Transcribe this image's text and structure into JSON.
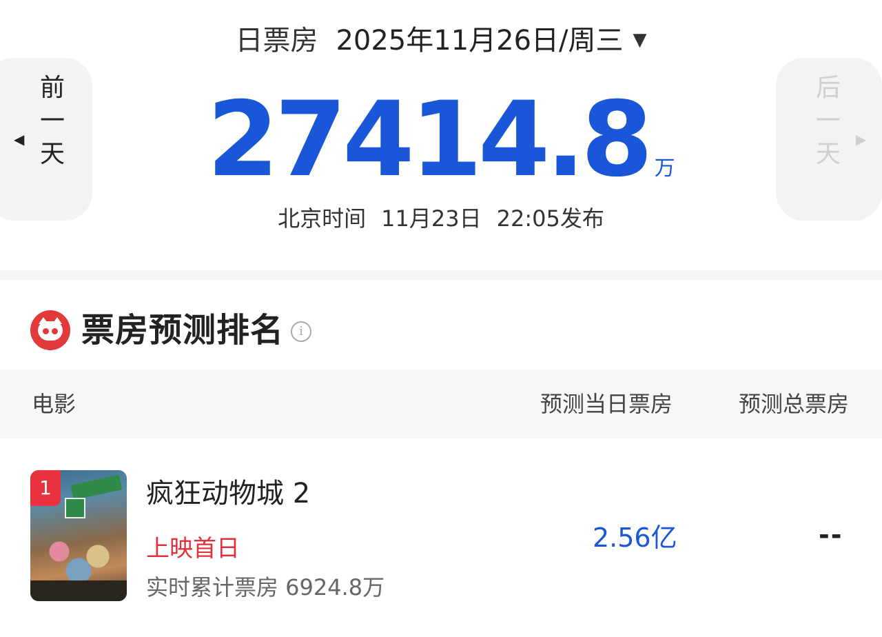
{
  "header": {
    "label": "日票房",
    "date": "2025年11月26日/周三",
    "caret": "▼"
  },
  "nav": {
    "prev_label": "前一天",
    "prev_chars": [
      "前",
      "一",
      "天"
    ],
    "prev_arrow": "◀",
    "next_label": "后一天",
    "next_chars": [
      "后",
      "一",
      "天"
    ],
    "next_arrow": "▶"
  },
  "total": {
    "value": "27414.8",
    "unit": "万"
  },
  "release": {
    "zone": "北京时间",
    "date": "11月23日",
    "time_text": "22:05发布"
  },
  "section": {
    "title": "票房预测排名",
    "info_glyph": "i",
    "logo": "maoyan-cat-icon"
  },
  "table": {
    "headers": {
      "movie": "电影",
      "predicted_day": "预测当日票房",
      "predicted_total": "预测总票房"
    },
    "rows": [
      {
        "rank": "1",
        "title": "疯狂动物城 2",
        "tag": "上映首日",
        "realtime": "实时累计票房 6924.8万",
        "predicted_day": "2.56亿",
        "predicted_total": "--"
      }
    ]
  },
  "colors": {
    "accent_blue": "#1a56d8",
    "accent_red": "#e23a3a",
    "tag_red": "#e0323a"
  }
}
